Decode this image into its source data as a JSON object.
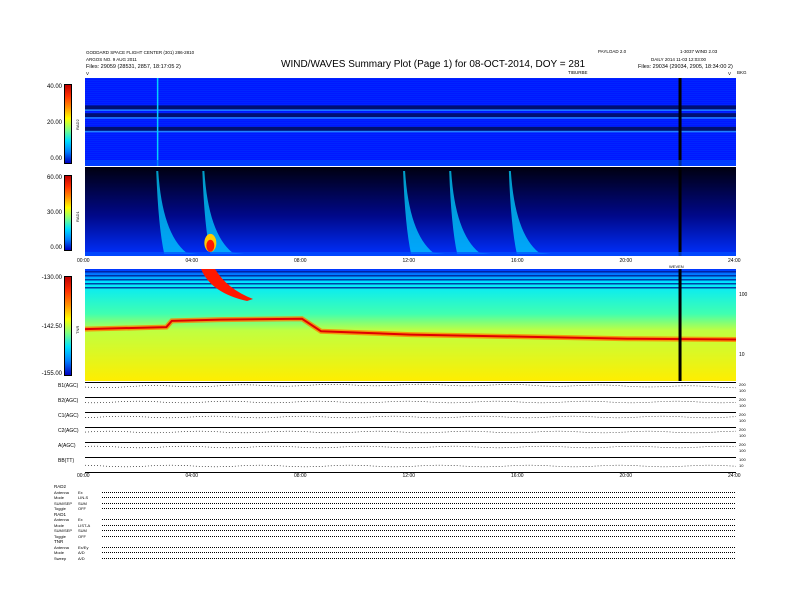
{
  "header": {
    "left_line1": "GODDARD SPACE FLIGHT CENTER (301) 286-2810",
    "left_line2": "ARGOS NO. 9 AUG 2011",
    "left_line3_label": "Files:",
    "left_line3_value": "29059 (28531, 2857, 18:17:05 2)",
    "right_line1": "PAYLOAD 2.0",
    "right_line2": "DAILY 2014 11-03 12:03:00",
    "right_line3_label": "Files:",
    "right_line3_value": "29034 (29034, 2905, 18:34:00 2)",
    "version": "1-3037  WIND 2.03",
    "title": "WIND/WAVES Summary Plot (Page 1) for 08-OCT-2014, DOY = 281",
    "sub_center": "TIBURBE",
    "sub_right": "BKG",
    "sub_marker": "V"
  },
  "colors": {
    "spectrogram_low": "#0018ff",
    "spectrogram_mid": "#00d0ff",
    "spectrogram_high": "#ff1800",
    "tnr_background": "#ffee00",
    "tnr_low": "#00e8ff",
    "gap": "#000000"
  },
  "rad2": {
    "label": "RAD2",
    "ticks": [
      "40.00",
      "20.00",
      "0.00"
    ]
  },
  "rad1": {
    "label": "RAD1",
    "ticks": [
      "60.00",
      "30.00",
      "0.00"
    ]
  },
  "tnr": {
    "label": "TNR",
    "ticks": [
      "-130.00",
      "-142.50",
      "-155.00"
    ],
    "right_ticks": [
      "100",
      "10"
    ],
    "marker": "WEVEN"
  },
  "time_axis": {
    "ticks": [
      "00:00",
      "04:00",
      "08:00",
      "12:00",
      "16:00",
      "20:00",
      "24:00"
    ]
  },
  "traces": [
    {
      "label": "B1(AGC)",
      "right_ticks": [
        "200",
        "100"
      ]
    },
    {
      "label": "B2(AGC)",
      "right_ticks": [
        "200",
        "100"
      ]
    },
    {
      "label": "C1(AGC)",
      "right_ticks": [
        "200",
        "100"
      ]
    },
    {
      "label": "C2(AGC)",
      "right_ticks": [
        "200",
        "100"
      ]
    },
    {
      "label": "A(AGC)",
      "right_ticks": [
        "200",
        "100"
      ]
    },
    {
      "label": "BB(TT)",
      "right_ticks": [
        "100",
        "10"
      ]
    }
  ],
  "status": {
    "groups": [
      {
        "name": "RAD2",
        "rows": [
          [
            "Antenna",
            "Ex"
          ],
          [
            "Mode",
            "LIN-S"
          ],
          [
            "SUM/SEP",
            "SUM"
          ],
          [
            "Toggle",
            "OFF"
          ]
        ]
      },
      {
        "name": "RAD1",
        "rows": [
          [
            "Antenna",
            "Ex"
          ],
          [
            "Mode",
            "LIST-A"
          ],
          [
            "SUM/SEP",
            "SUM"
          ],
          [
            "Toggle",
            "OFF"
          ]
        ]
      },
      {
        "name": "TNR",
        "rows": [
          [
            "Antenna",
            "Ex/Ey"
          ],
          [
            "Mode",
            "A/D"
          ],
          [
            "Sweep",
            "A/D"
          ]
        ]
      }
    ]
  },
  "chart_data": [
    {
      "type": "heatmap",
      "title": "WIND/WAVES Summary Plot (Page 1) for 08-OCT-2014, DOY = 281",
      "ylabel": "RAD2",
      "ylim": [
        0,
        40
      ],
      "xlim": [
        "00:00",
        "24:00"
      ],
      "x_ticks": [
        "00:00",
        "04:00",
        "08:00",
        "12:00",
        "16:00",
        "20:00",
        "24:00"
      ],
      "features": [
        {
          "kind": "narrowband",
          "y": 17,
          "intensity": "low"
        },
        {
          "kind": "narrowband",
          "y": 24,
          "intensity": "low"
        },
        {
          "kind": "narrowband",
          "y": 28,
          "intensity": "low"
        },
        {
          "kind": "vertical",
          "x": 2.65,
          "intensity": "mid"
        },
        {
          "kind": "data_gap",
          "x": 21.9
        }
      ]
    },
    {
      "type": "heatmap",
      "ylabel": "RAD1",
      "ylim": [
        0,
        60
      ],
      "xlim": [
        "00:00",
        "24:00"
      ],
      "features": [
        {
          "kind": "burst",
          "x": 2.7,
          "intensity": "mid"
        },
        {
          "kind": "burst",
          "x": 4.4,
          "intensity": "high"
        },
        {
          "kind": "burst",
          "x": 11.8,
          "intensity": "mid"
        },
        {
          "kind": "burst",
          "x": 13.5,
          "intensity": "mid"
        },
        {
          "kind": "burst",
          "x": 15.7,
          "intensity": "mid"
        },
        {
          "kind": "data_gap",
          "x": 21.9
        }
      ]
    },
    {
      "type": "heatmap",
      "ylabel": "TNR",
      "ylim": [
        -155,
        -130
      ],
      "xlim": [
        "00:00",
        "24:00"
      ],
      "plasma_line": [
        {
          "x": 0,
          "y": -143.5
        },
        {
          "x": 3.0,
          "y": -143.0
        },
        {
          "x": 3.2,
          "y": -141.5
        },
        {
          "x": 5.0,
          "y": -141.2
        },
        {
          "x": 8.0,
          "y": -141.0
        },
        {
          "x": 8.7,
          "y": -144.0
        },
        {
          "x": 12.0,
          "y": -144.8
        },
        {
          "x": 16.0,
          "y": -145.3
        },
        {
          "x": 20.0,
          "y": -145.8
        },
        {
          "x": 24.0,
          "y": -146.0
        }
      ],
      "features": [
        {
          "kind": "burst",
          "x": 4.5,
          "intensity": "high"
        },
        {
          "kind": "data_gap",
          "x": 21.9
        }
      ]
    }
  ]
}
